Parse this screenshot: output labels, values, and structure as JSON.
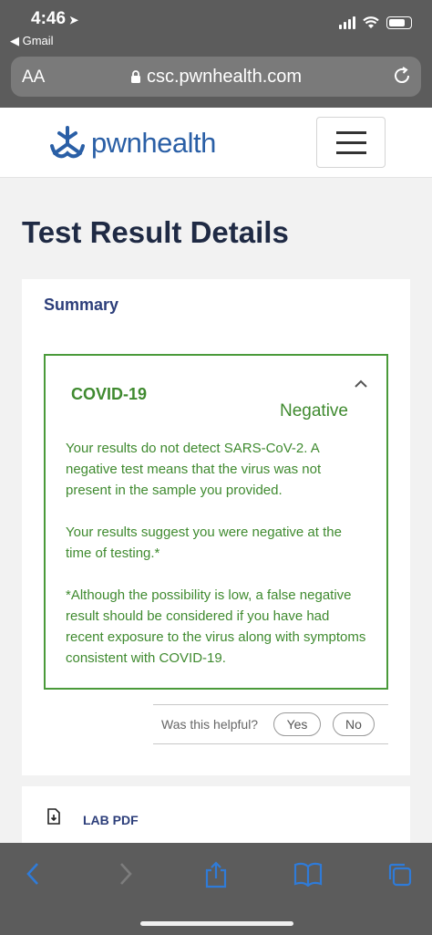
{
  "status_bar": {
    "time": "4:46",
    "back_app": "Gmail"
  },
  "browser": {
    "text_size": "AA",
    "url": "csc.pwnhealth.com"
  },
  "header": {
    "brand": "pwnhealth"
  },
  "page": {
    "title": "Test Result Details"
  },
  "summary": {
    "heading": "Summary",
    "result": {
      "test_name": "COVID-19",
      "status": "Negative",
      "paragraphs": [
        "Your results do not detect SARS-CoV-2. A negative test means that the virus was not present in the sample you provided.",
        "Your results suggest you were negative at the time of testing.*",
        "*Although the possibility is low, a false negative result should be considered if you have had recent exposure to the virus along with symptoms consistent with COVID-19."
      ]
    },
    "feedback": {
      "question": "Was this helpful?",
      "yes": "Yes",
      "no": "No"
    }
  },
  "documents": {
    "lab_pdf": "LAB PDF"
  },
  "colors": {
    "accent_green": "#3f8a2f",
    "brand_blue": "#2a5fa6",
    "heading_navy": "#2c3e7a",
    "ios_blue": "#2f7bd8"
  },
  "toolbar": {
    "icons": [
      "back-icon",
      "forward-icon",
      "share-icon",
      "bookmarks-icon",
      "tabs-icon"
    ]
  }
}
